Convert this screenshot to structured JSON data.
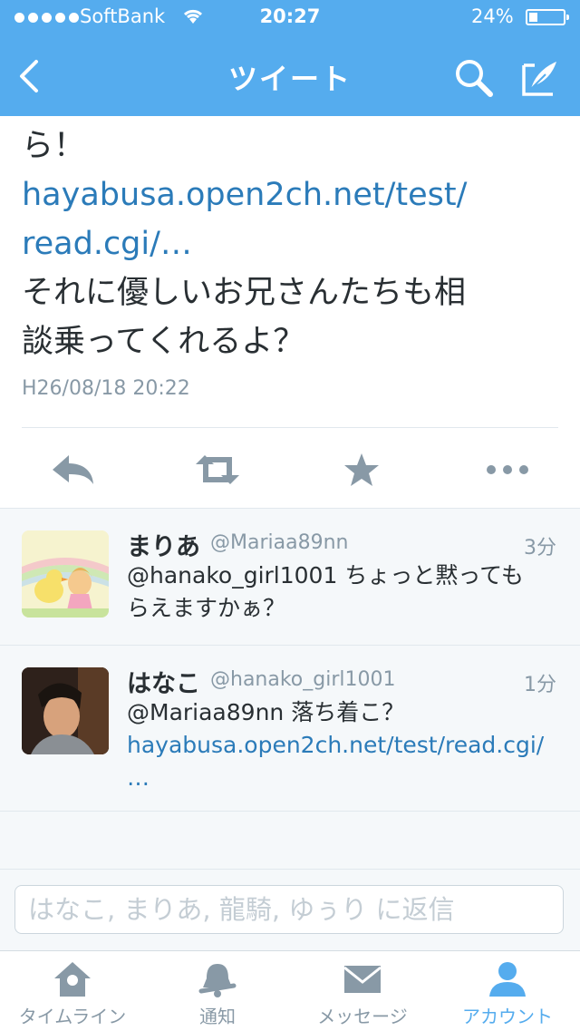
{
  "status_bar": {
    "carrier": "SoftBank",
    "time": "20:27",
    "battery_percent": "24%",
    "battery_level": 0.24,
    "signal_bars": 5
  },
  "nav": {
    "title": "ツイート",
    "back_icon": "chevron-left-icon",
    "search_icon": "search-icon",
    "compose_icon": "compose-icon"
  },
  "tweet": {
    "line1": "ら！",
    "link_line1": "hayabusa.open2ch.net/test/",
    "link_line2": "read.cgi/…",
    "line2": "それに優しいお兄さんたちも相",
    "line3": "談乗ってくれるよ？",
    "timestamp": "H26/08/18 20:22",
    "actions": [
      "reply-icon",
      "retweet-icon",
      "favorite-icon",
      "more-icon"
    ]
  },
  "replies": [
    {
      "name": "まりあ",
      "handle": "@Mariaa89nn",
      "ago": "3分",
      "text_line1": "@hanako_girl1001 ちょっと黙っても",
      "text_line2": "らえますかぁ？"
    },
    {
      "name": "はなこ",
      "handle": "@hanako_girl1001",
      "ago": "1分",
      "text_line1": "@Mariaa89nn 落ち着こ？",
      "link_line1": "hayabusa.open2ch.net/test/read.cgi/",
      "link_line2": "…"
    }
  ],
  "composer": {
    "placeholder": "はなこ, まりあ, 龍騎, ゆぅり に返信"
  },
  "tabbar": {
    "active_tab": "アカウント",
    "tabs": [
      {
        "label": "タイムライン",
        "icon": "home-icon"
      },
      {
        "label": "通知",
        "icon": "bell-icon"
      },
      {
        "label": "メッセージ",
        "icon": "envelope-icon"
      },
      {
        "label": "アカウント",
        "icon": "person-icon"
      }
    ]
  },
  "colors": {
    "brand": "#55acee",
    "link": "#2b7bb9",
    "muted": "#8899a6",
    "text": "#292f33"
  }
}
